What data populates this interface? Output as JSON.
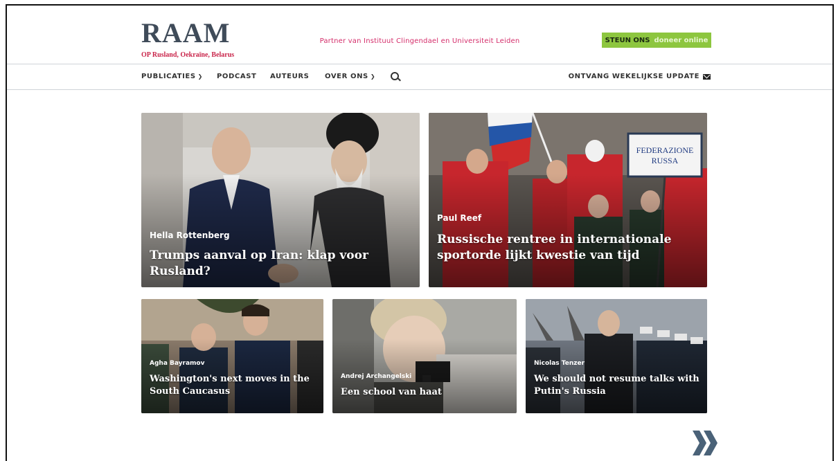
{
  "header": {
    "logo_word": "RAAM",
    "logo_sub_op": "OP",
    "logo_sub_rest": "Rusland, Oekraïne, Belarus",
    "tagline": "Partner van Instituut Clingendael en Universiteit Leiden",
    "steun_label": "STEUN ONS",
    "doneer_label": "doneer online"
  },
  "nav": {
    "items": [
      {
        "label": "PUBLICATIES"
      },
      {
        "label": "PODCAST"
      },
      {
        "label": "AUTEURS"
      },
      {
        "label": "OVER ONS"
      }
    ],
    "update_label": "ONTVANG WEKELIJKSE UPDATE"
  },
  "articles": [
    {
      "author": "Hella Rottenberg",
      "title": "Trumps aanval op Iran: klap voor Rusland?"
    },
    {
      "author": "Paul Reef",
      "title": "Russische rentree in internationale sportorde lijkt kwestie van tijd",
      "sign_text": "FEDERAZIONE RUSSA"
    },
    {
      "author": "Agha Bayramov",
      "title": "Washington's next moves in the South Caucasus"
    },
    {
      "author": "Andrej Archangelski",
      "title": "Een school van haat"
    },
    {
      "author": "Nicolas Tenzer",
      "title": "We should not resume talks with Putin's Russia"
    }
  ],
  "colors": {
    "brand_red": "#c9254a",
    "steun_green": "#8dc63f",
    "logo_slate": "#3f4b59",
    "next_arrow": "#4a6278"
  }
}
